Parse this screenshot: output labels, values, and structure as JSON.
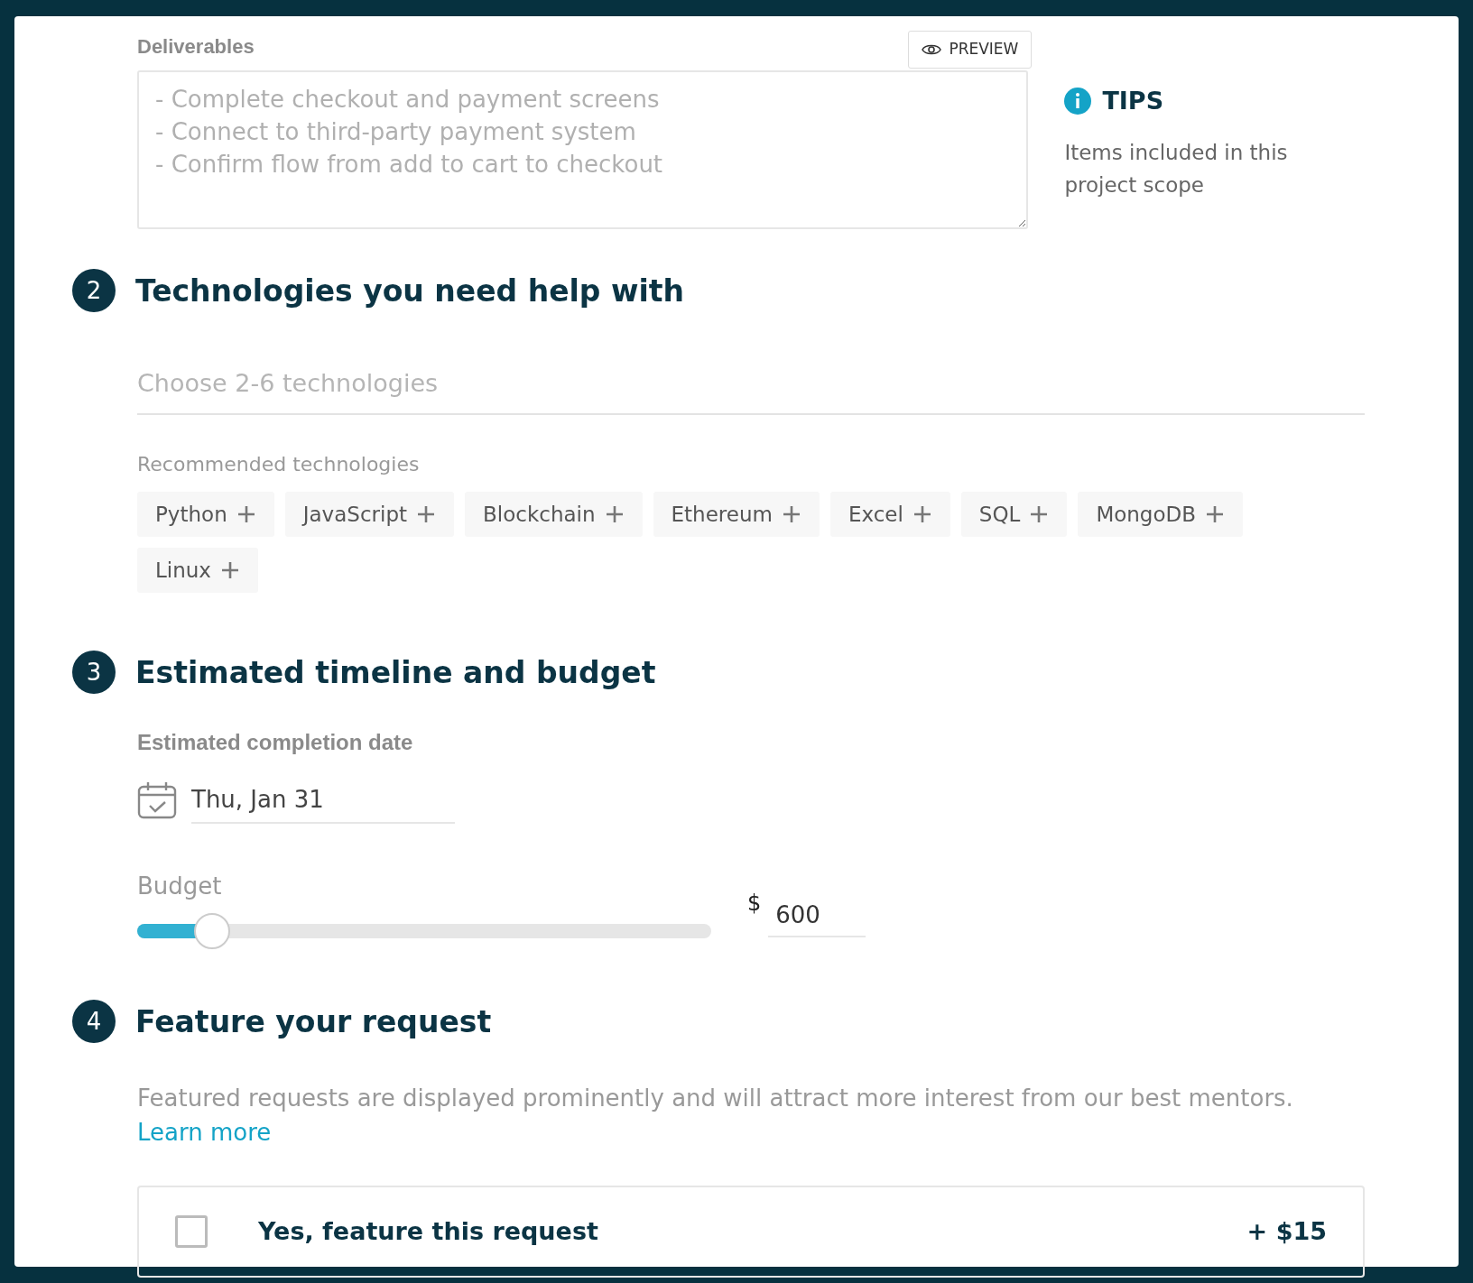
{
  "deliverables": {
    "label": "Deliverables",
    "preview_button": "PREVIEW",
    "placeholder": "- Complete checkout and payment screens\n- Connect to third-party payment system\n- Confirm flow from add to cart to checkout"
  },
  "tips": {
    "title": "TIPS",
    "text": "Items included in this project scope"
  },
  "technologies": {
    "number": "2",
    "heading": "Technologies you need help with",
    "placeholder": "Choose 2-6 technologies",
    "recommended_label": "Recommended technologies",
    "chips": [
      {
        "label": "Python"
      },
      {
        "label": "JavaScript"
      },
      {
        "label": "Blockchain"
      },
      {
        "label": "Ethereum"
      },
      {
        "label": "Excel"
      },
      {
        "label": "SQL"
      },
      {
        "label": "MongoDB"
      },
      {
        "label": "Linux"
      }
    ]
  },
  "timeline": {
    "number": "3",
    "heading": "Estimated timeline and budget",
    "date_label": "Estimated completion date",
    "date_value": "Thu, Jan 31",
    "budget_label": "Budget",
    "budget_slider": {
      "level": 0.13
    },
    "currency": "$",
    "budget_value": "600"
  },
  "feature": {
    "number": "4",
    "heading": "Feature your request",
    "description": "Featured requests are displayed prominently and will attract more interest from our best mentors.",
    "link": "Learn more",
    "option_label": "Yes, feature this request",
    "option_checked": false,
    "price": "+ $15"
  }
}
